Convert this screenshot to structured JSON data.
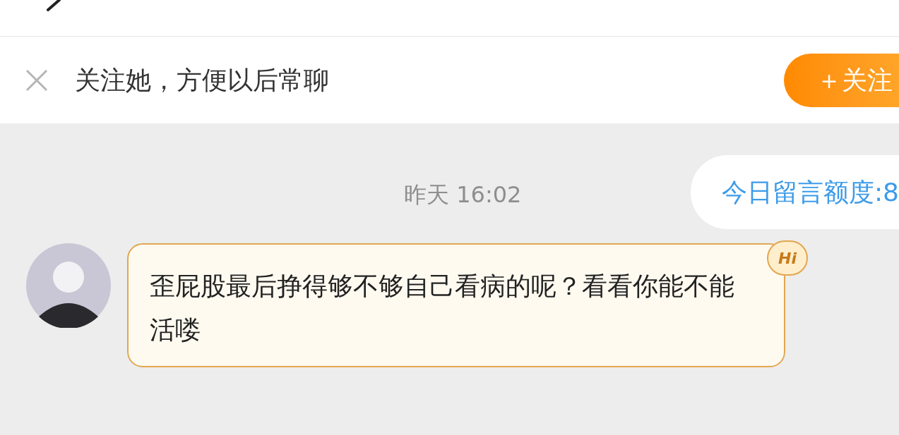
{
  "follow_bar": {
    "prompt": "关注她，方便以后常聊",
    "button": "＋关注"
  },
  "messages": [
    {
      "kind": "timestamp",
      "text": "昨天 16:02"
    },
    {
      "kind": "notice",
      "text": "今日留言额度:8"
    },
    {
      "kind": "incoming",
      "text": "歪屁股最后挣得够不够自己看病的呢？看看你能不能活喽",
      "badge": "Hi"
    }
  ]
}
